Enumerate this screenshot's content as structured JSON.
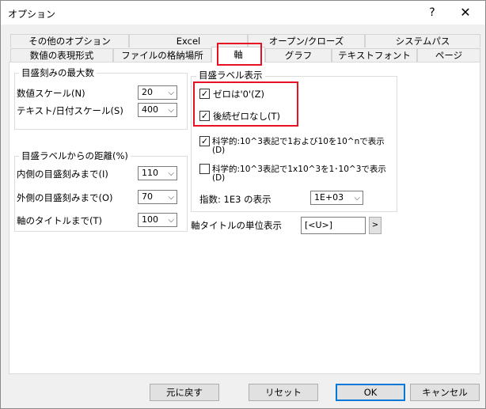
{
  "window": {
    "title": "オプション",
    "help_label": "?",
    "close_label": "✕"
  },
  "tabs": {
    "row1": [
      "その他のオプション",
      "Excel",
      "オープン/クローズ",
      "システムパス"
    ],
    "row2": [
      "数値の表現形式",
      "ファイルの格納場所",
      "軸",
      "グラフ",
      "テキストフォント",
      "ページ"
    ],
    "active": "軸"
  },
  "tick_max": {
    "title": "目盛刻みの最大数",
    "numeric_label": "数値スケール(N)",
    "numeric_value": "20",
    "textdate_label": "テキスト/日付スケール(S)",
    "textdate_value": "400"
  },
  "label_distance": {
    "title": "目盛ラベルからの距離(%)",
    "inner_label": "内側の目盛刻みまで(I)",
    "inner_value": "110",
    "outer_label": "外側の目盛刻みまで(O)",
    "outer_value": "70",
    "axis_title_label": "軸のタイトルまで(T)",
    "axis_title_value": "100"
  },
  "tick_label_display": {
    "title": "目盛ラベル表示",
    "zero_is_0": {
      "label": "ゼロは'0'(Z)",
      "checked": true
    },
    "trailing_zero": {
      "label": "後続ゼロなし(T)",
      "checked": true
    },
    "sci1": {
      "label_line1": "科学的:10^3表記で1および10を10^nで表示",
      "label_line2": "(D)",
      "checked": true
    },
    "sci2": {
      "label_line1": "科学的:10^3表記で1x10^3を1･10^3で表示",
      "label_line2": "(D)",
      "checked": false
    },
    "exponent_label": "指数: 1E3 の表示",
    "exponent_value": "1E+03"
  },
  "axis_unit": {
    "label": "軸タイトルの単位表示",
    "value": "[<U>]",
    "arrow": ">"
  },
  "buttons": {
    "reset_default": "元に戻す",
    "reset": "リセット",
    "ok": "OK",
    "cancel": "キャンセル"
  },
  "colors": {
    "highlight": "#e81123",
    "default_button_border": "#0078d7"
  }
}
